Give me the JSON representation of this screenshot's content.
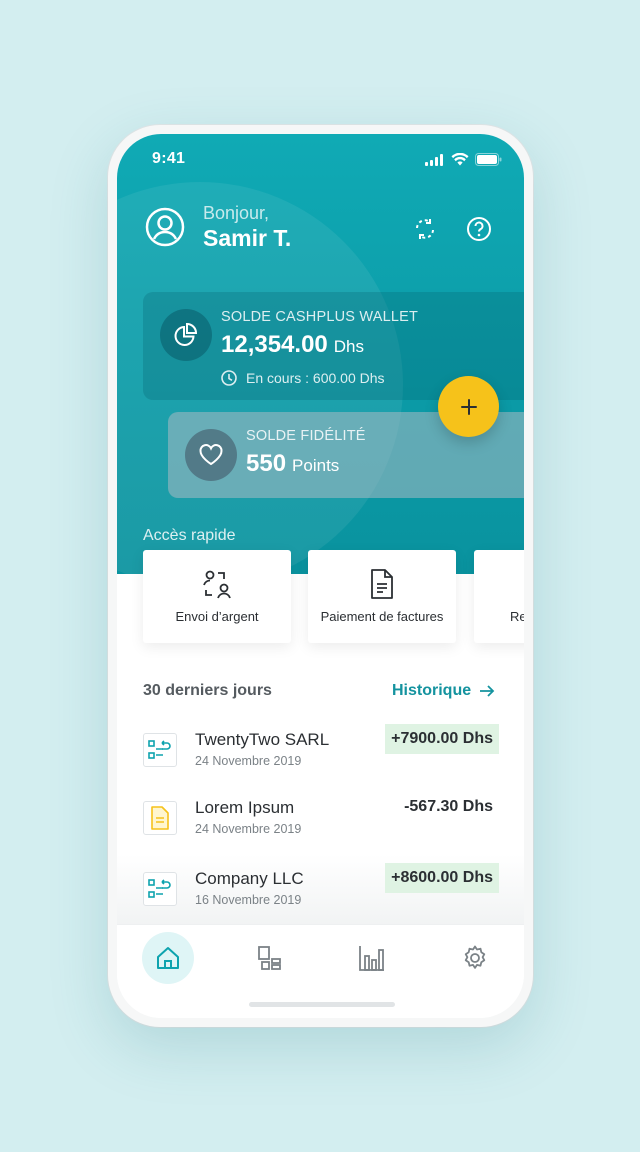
{
  "status": {
    "time": "9:41"
  },
  "header": {
    "greeting": "Bonjour,",
    "user_name": "Samir T."
  },
  "wallet": {
    "label": "SOLDE CASHPLUS WALLET",
    "amount": "12,354.00",
    "currency": "Dhs",
    "pending": "En cours : 600.00 Dhs"
  },
  "loyalty": {
    "label": "SOLDE FIDÉLITÉ",
    "amount": "550",
    "unit": "Points"
  },
  "quick_access": {
    "title": "Accès rapide",
    "items": [
      {
        "label": "Envoi d’argent",
        "icon": "send-money-icon"
      },
      {
        "label": "Paiement de factures",
        "icon": "invoice-icon"
      },
      {
        "label": "Re",
        "icon": "partial-icon"
      }
    ]
  },
  "recent": {
    "title": "30 derniers jours",
    "history_link": "Historique",
    "transactions": [
      {
        "name": "TwentyTwo SARL",
        "date": "24 Novembre 2019",
        "amount": "+7900.00 Dhs",
        "icon": "transfer-icon"
      },
      {
        "name": "Lorem Ipsum",
        "date": "24 Novembre 2019",
        "amount": "-567.30 Dhs",
        "icon": "bill-icon"
      },
      {
        "name": "Company LLC",
        "date": "16 Novembre 2019",
        "amount": "+8600.00 Dhs",
        "icon": "transfer-icon"
      }
    ]
  },
  "nav": [
    "home-icon",
    "apps-icon",
    "stats-icon",
    "settings-icon"
  ],
  "colors": {
    "primary": "#0ea3ae",
    "accent": "#f6c21a",
    "positive_bg": "#dff3e3",
    "link": "#14939f"
  }
}
